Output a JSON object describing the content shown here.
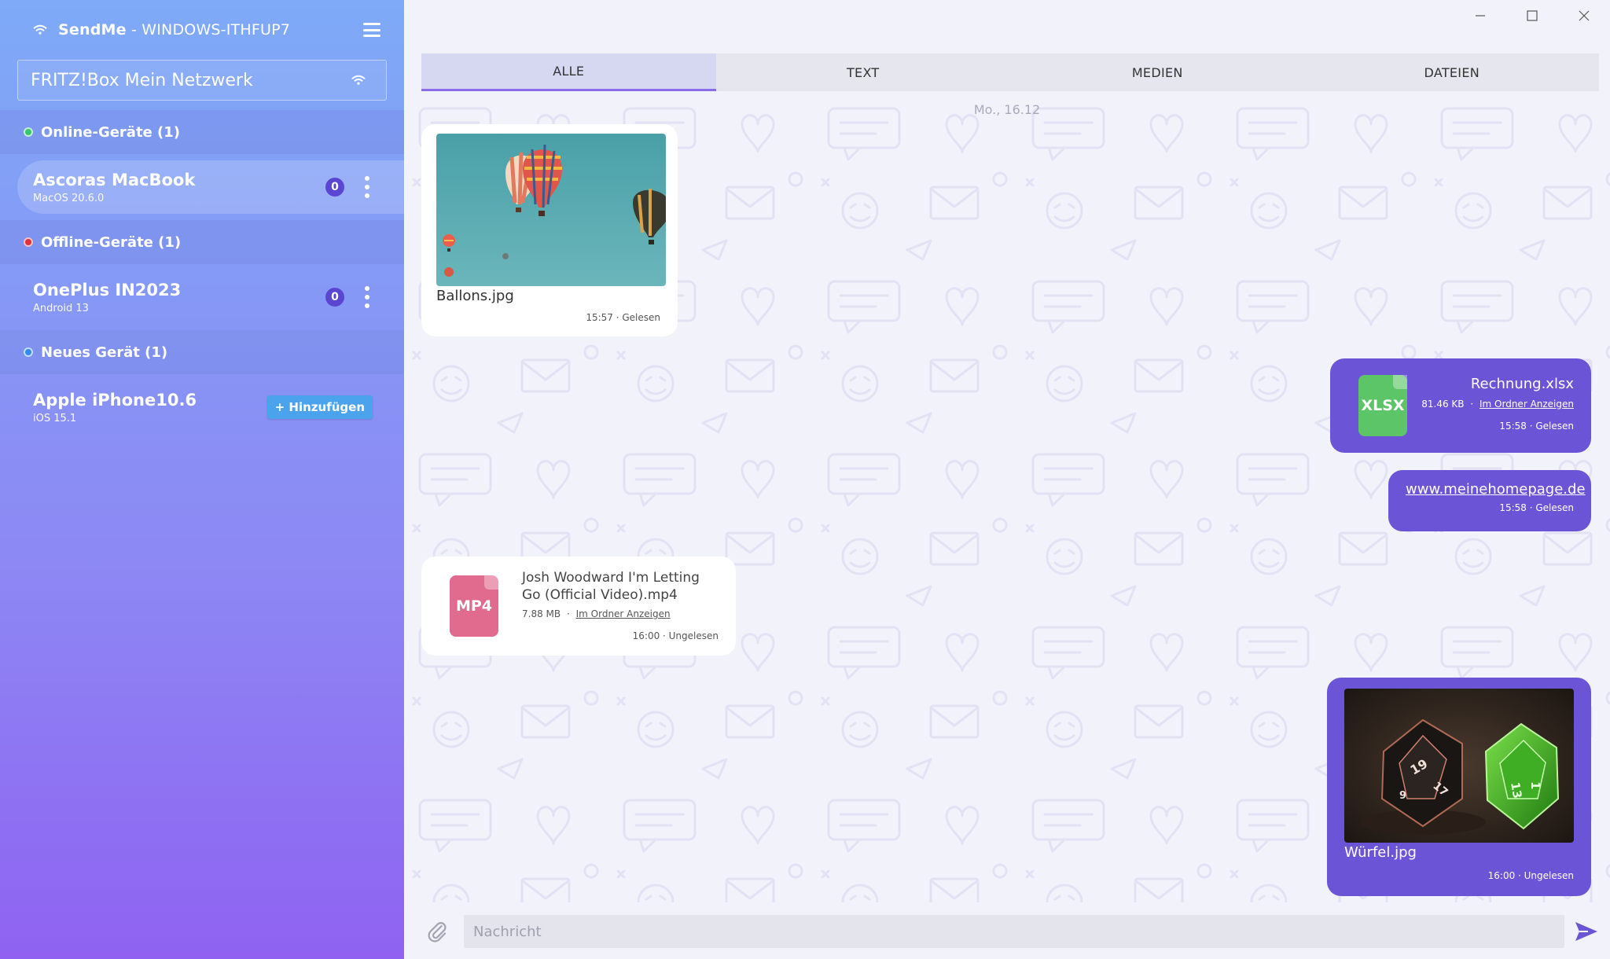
{
  "app": {
    "name": "SendMe",
    "separator": " - ",
    "host": "WINDOWS-ITHFUP7"
  },
  "network": {
    "label": "FRITZ!Box Mein Netzwerk"
  },
  "sections": {
    "online": {
      "label": "Online-Geräte (1)"
    },
    "offline": {
      "label": "Offline-Geräte (1)"
    },
    "new": {
      "label": "Neues Gerät (1)"
    }
  },
  "devices": [
    {
      "name": "Ascoras MacBook",
      "os": "MacOS 20.6.0",
      "count": "0"
    },
    {
      "name": "OnePlus IN2023",
      "os": "Android 13",
      "count": "0"
    },
    {
      "name": "Apple iPhone10.6",
      "os": "iOS 15.1",
      "action": "+ Hinzufügen"
    }
  ],
  "tabs": [
    "ALLE",
    "TEXT",
    "MEDIEN",
    "DATEIEN"
  ],
  "chat": {
    "date": "Mo., 16.12",
    "messages": [
      {
        "type": "image",
        "filename": "Ballons.jpg",
        "meta": "15:57 · Gelesen"
      },
      {
        "type": "file",
        "icon": "XLSX",
        "filename": "Rechnung.xlsx",
        "size": "81.46 KB",
        "dot": "·",
        "link": "Im Ordner Anzeigen",
        "meta": "15:58 · Gelesen",
        "icon_color": "#5cc567"
      },
      {
        "type": "link",
        "url": "www.meinehomepage.de",
        "meta": "15:58 · Gelesen"
      },
      {
        "type": "file",
        "icon": "MP4",
        "filename": "Josh Woodward I'm Letting Go (Official Video).mp4",
        "size": "7.88 MB",
        "dot": "·",
        "link": "Im Ordner Anzeigen",
        "meta": "16:00 · Ungelesen",
        "icon_color": "#e06b8e"
      },
      {
        "type": "image",
        "filename": "Würfel.jpg",
        "meta": "16:00 · Ungelesen"
      }
    ]
  },
  "composer": {
    "placeholder": "Nachricht"
  },
  "colors": {
    "accent": "#6b55d6",
    "tab_active": "#8a6be8"
  }
}
